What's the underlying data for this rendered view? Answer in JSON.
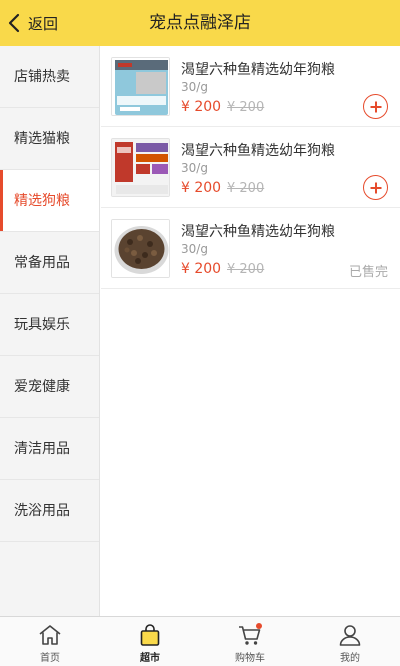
{
  "header": {
    "back_label": "返回",
    "title": "宠点点融泽店"
  },
  "sidebar": {
    "items": [
      {
        "label": "店铺热卖",
        "active": false
      },
      {
        "label": "精选猫粮",
        "active": false
      },
      {
        "label": "精选狗粮",
        "active": true
      },
      {
        "label": "常备用品",
        "active": false
      },
      {
        "label": "玩具娱乐",
        "active": false
      },
      {
        "label": "爱宠健康",
        "active": false
      },
      {
        "label": "清洁用品",
        "active": false
      },
      {
        "label": "洗浴用品",
        "active": false
      }
    ]
  },
  "products": [
    {
      "name": "渴望六种鱼精选幼年狗粮",
      "unit": "30/g",
      "price": "¥ 200",
      "original_price": "¥ 200",
      "action": "add"
    },
    {
      "name": "渴望六种鱼精选幼年狗粮",
      "unit": "30/g",
      "price": "¥ 200",
      "original_price": "¥ 200",
      "action": "add"
    },
    {
      "name": "渴望六种鱼精选幼年狗粮",
      "unit": "30/g",
      "price": "¥ 200",
      "original_price": "¥ 200",
      "action": "sold_out",
      "sold_out_label": "已售完"
    }
  ],
  "tabbar": {
    "items": [
      {
        "label": "首页",
        "icon": "home-icon",
        "active": false
      },
      {
        "label": "超市",
        "icon": "shopping-bag-icon",
        "active": true
      },
      {
        "label": "购物车",
        "icon": "cart-icon",
        "active": false,
        "badge_dot": true
      },
      {
        "label": "我的",
        "icon": "user-icon",
        "active": false
      }
    ]
  },
  "colors": {
    "header_bg": "#f9d94a",
    "accent": "#e64b2c",
    "sidebar_bg": "#f4f4f4"
  }
}
